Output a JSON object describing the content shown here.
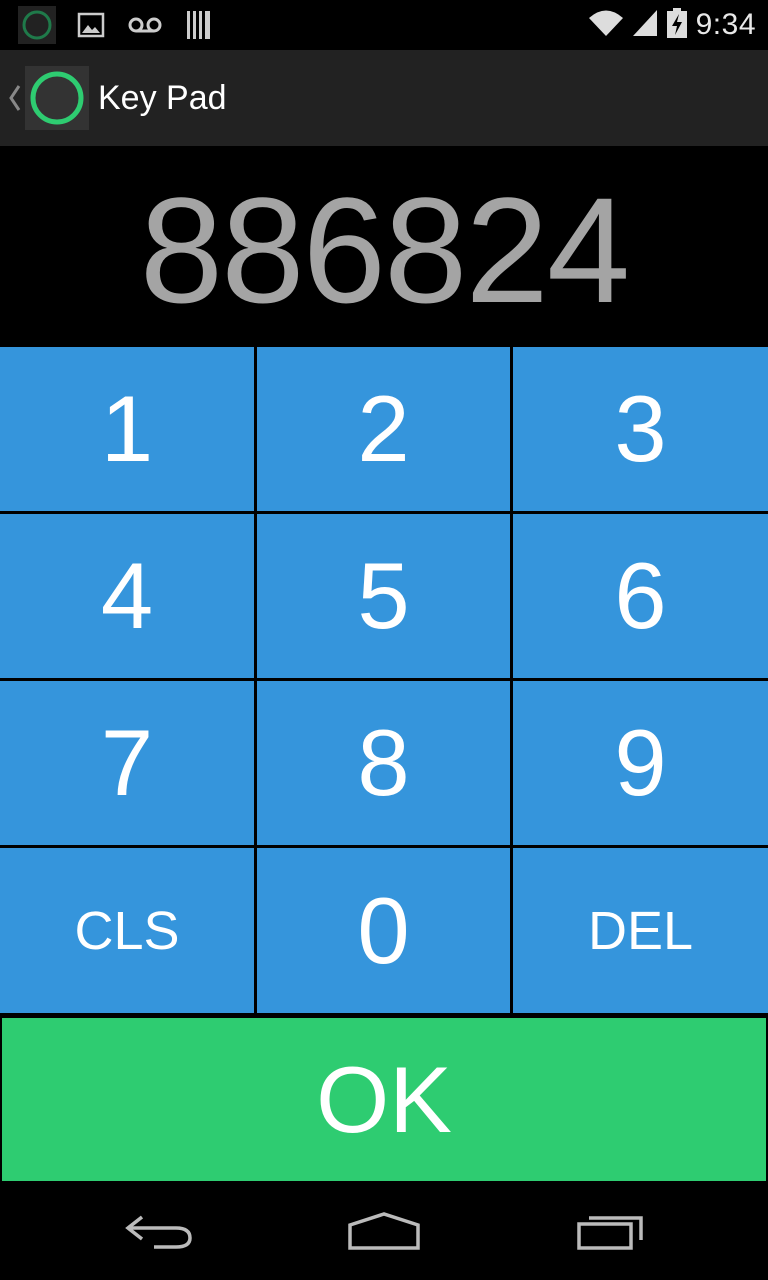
{
  "status_bar": {
    "time": "9:34",
    "left_icons": [
      "app-ring-icon",
      "image-icon",
      "voicemail-icon",
      "barcode-icon"
    ],
    "right_icons": [
      "wifi-icon",
      "signal-icon",
      "battery-charging-icon"
    ]
  },
  "action_bar": {
    "title": "Key Pad",
    "logo_color": "#2ecc71"
  },
  "display": {
    "value": "886824"
  },
  "keypad": {
    "keys": [
      {
        "label": "1"
      },
      {
        "label": "2"
      },
      {
        "label": "3"
      },
      {
        "label": "4"
      },
      {
        "label": "5"
      },
      {
        "label": "6"
      },
      {
        "label": "7"
      },
      {
        "label": "8"
      },
      {
        "label": "9"
      },
      {
        "label": "CLS"
      },
      {
        "label": "0"
      },
      {
        "label": "DEL"
      }
    ],
    "ok_label": "OK",
    "key_color": "#3595dc",
    "ok_color": "#2ecc71"
  },
  "nav_bar": {
    "buttons": [
      "back-icon",
      "home-icon",
      "recent-apps-icon"
    ]
  }
}
